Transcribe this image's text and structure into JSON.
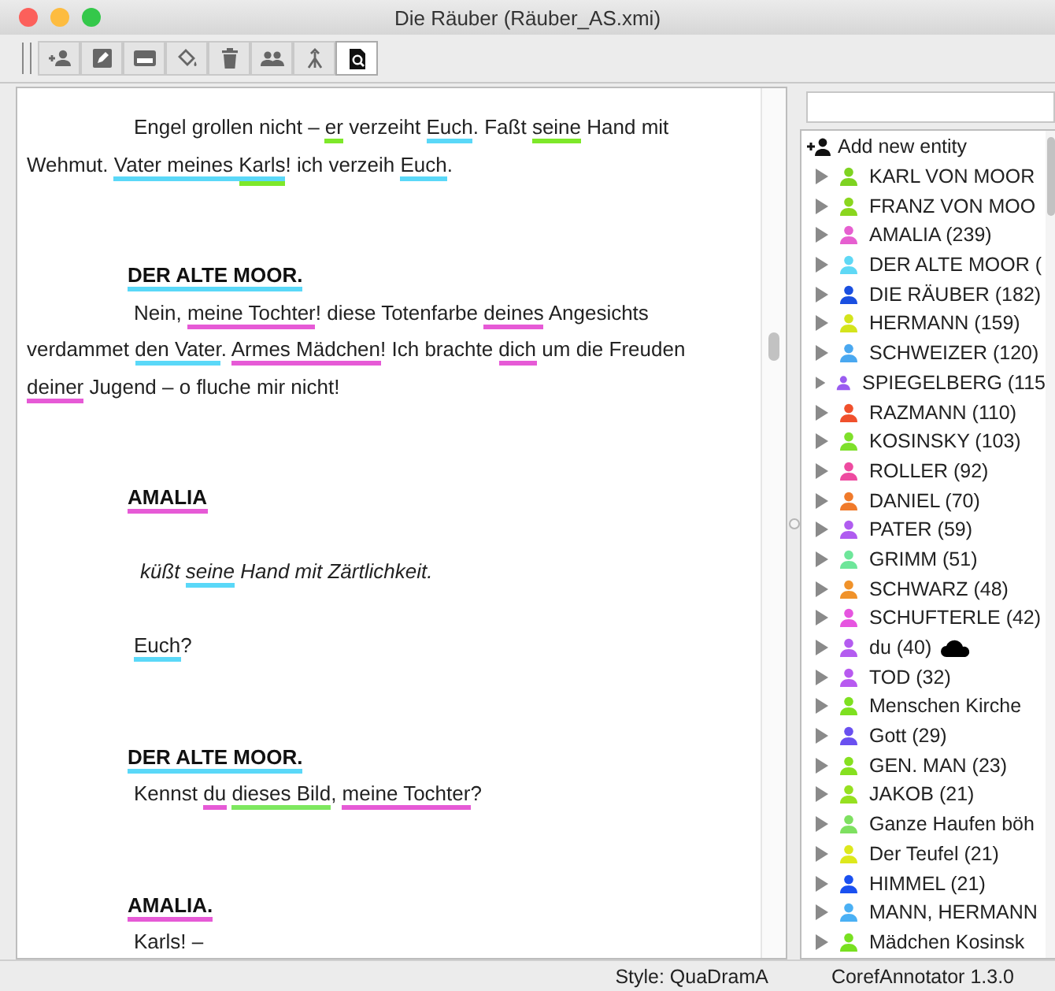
{
  "window": {
    "title": "Die Räuber (Räuber_AS.xmi)"
  },
  "toolbar": [
    {
      "kind": "add-entity",
      "selected": false
    },
    {
      "kind": "edit",
      "selected": false
    },
    {
      "kind": "form",
      "selected": false
    },
    {
      "kind": "fill",
      "selected": false
    },
    {
      "kind": "delete",
      "selected": false
    },
    {
      "kind": "group",
      "selected": false
    },
    {
      "kind": "merge",
      "selected": false
    },
    {
      "kind": "search",
      "selected": true
    }
  ],
  "text": [
    {
      "kind": "speech",
      "segments": [
        {
          "text": "Engel grollen nicht – "
        },
        {
          "text": "er",
          "color": "#7ee82a"
        },
        {
          "text": " verzeiht "
        },
        {
          "text": "Euch",
          "color": "#5ad8f8"
        },
        {
          "text": ". Faßt "
        },
        {
          "text": "seine",
          "color": "#7ee82a"
        },
        {
          "text": " Hand mit Wehmut. "
        },
        {
          "text": "Vater meines ",
          "color": "#5ad8f8"
        },
        {
          "text": "Karls",
          "mentions": [
            {
              "color": "#5ad8f8"
            },
            {
              "color": "#7ee82a"
            }
          ]
        },
        {
          "text": "! ich verzeih "
        },
        {
          "text": "Euch",
          "color": "#5ad8f8"
        },
        {
          "text": "."
        }
      ]
    },
    {
      "kind": "speaker",
      "segments": [
        {
          "text": "DER ALTE MOOR.",
          "color": "#5ad8f8"
        }
      ]
    },
    {
      "kind": "speech",
      "segments": [
        {
          "text": "Nein, "
        },
        {
          "text": "meine Tochter",
          "color": "#e65ad6"
        },
        {
          "text": "! diese Totenfarbe "
        },
        {
          "text": "deines",
          "color": "#e65ad6"
        },
        {
          "text": " Angesichts verdammet "
        },
        {
          "text": "den Vater",
          "color": "#5ad8f8"
        },
        {
          "text": ". "
        },
        {
          "text": "Armes Mädchen",
          "color": "#e65ad6"
        },
        {
          "text": "! Ich brachte "
        },
        {
          "text": "dich",
          "color": "#e65ad6"
        },
        {
          "text": " um die Freuden "
        },
        {
          "text": "deiner",
          "color": "#e65ad6"
        },
        {
          "text": " Jugend – o fluche mir nicht!"
        }
      ]
    },
    {
      "kind": "speaker",
      "segments": [
        {
          "text": "AMALIA",
          "color": "#e65ad6"
        }
      ]
    },
    {
      "kind": "stage",
      "segments": [
        {
          "text": "küßt "
        },
        {
          "text": "seine",
          "color": "#5ad8f8"
        },
        {
          "text": " Hand mit Zärtlichkeit."
        }
      ]
    },
    {
      "kind": "speech",
      "segments": [
        {
          "text": "Euch",
          "color": "#5ad8f8"
        },
        {
          "text": "?"
        }
      ]
    },
    {
      "kind": "speaker",
      "segments": [
        {
          "text": "DER ALTE MOOR.",
          "color": "#5ad8f8"
        }
      ]
    },
    {
      "kind": "speech",
      "segments": [
        {
          "text": "Kennst "
        },
        {
          "text": "du",
          "color": "#e65ad6"
        },
        {
          "text": "dieses Bild",
          "color": "#7ee860",
          "space_before": true
        },
        {
          "text": ", "
        },
        {
          "text": "meine Tochter",
          "color": "#e65ad6"
        },
        {
          "text": "?"
        }
      ]
    },
    {
      "kind": "speaker",
      "segments": [
        {
          "text": "AMALIA.",
          "color": "#e65ad6"
        }
      ]
    },
    {
      "kind": "speech",
      "segments": [
        {
          "text": "Karls! –"
        }
      ]
    }
  ],
  "entities": {
    "add_label": "Add new entity",
    "items": [
      {
        "label": "KARL VON MOOR",
        "color": "#7ed321"
      },
      {
        "label": "FRANZ VON MOO",
        "color": "#8ad61e"
      },
      {
        "label": "AMALIA (239)",
        "color": "#e65fd0"
      },
      {
        "label": "DER ALTE MOOR (",
        "color": "#5fd8f5"
      },
      {
        "label": "DIE RÄUBER (182)",
        "color": "#1a4fe0"
      },
      {
        "label": "HERMANN (159)",
        "color": "#d4e41c"
      },
      {
        "label": "SCHWEIZER (120)",
        "color": "#4aa8f0"
      },
      {
        "label": "SPIEGELBERG (115",
        "color": "#9a5cf0"
      },
      {
        "label": "RAZMANN (110)",
        "color": "#f0502c"
      },
      {
        "label": "KOSINSKY (103)",
        "color": "#7ee02a"
      },
      {
        "label": "ROLLER (92)",
        "color": "#ee4aa0"
      },
      {
        "label": "DANIEL (70)",
        "color": "#f07a2a"
      },
      {
        "label": "PATER (59)",
        "color": "#b05cf0"
      },
      {
        "label": "GRIMM (51)",
        "color": "#6ee69a"
      },
      {
        "label": "SCHWARZ (48)",
        "color": "#f0922a"
      },
      {
        "label": "SCHUFTERLE (42)",
        "color": "#e655e0"
      },
      {
        "label": "du (40)",
        "color": "#b45cf0",
        "cloud": true
      },
      {
        "label": "TOD (32)",
        "color": "#b85af0"
      },
      {
        "label": "Menschen Kirche",
        "color": "#7ee020"
      },
      {
        "label": "Gott (29)",
        "color": "#6a50f0"
      },
      {
        "label": "GEN. MAN (23)",
        "color": "#86e020"
      },
      {
        "label": "JAKOB (21)",
        "color": "#96e020"
      },
      {
        "label": "Ganze Haufen böh",
        "color": "#7ee060"
      },
      {
        "label": "Der Teufel (21)",
        "color": "#dde81c"
      },
      {
        "label": "HIMMEL (21)",
        "color": "#1a50f0"
      },
      {
        "label": "MANN, HERMANN",
        "color": "#4ab0f4"
      },
      {
        "label": "Mädchen Kosinsk",
        "color": "#78e020"
      }
    ]
  },
  "status_bar": {
    "style": "Style: QuaDramA",
    "version": "CorefAnnotator 1.3.0"
  }
}
